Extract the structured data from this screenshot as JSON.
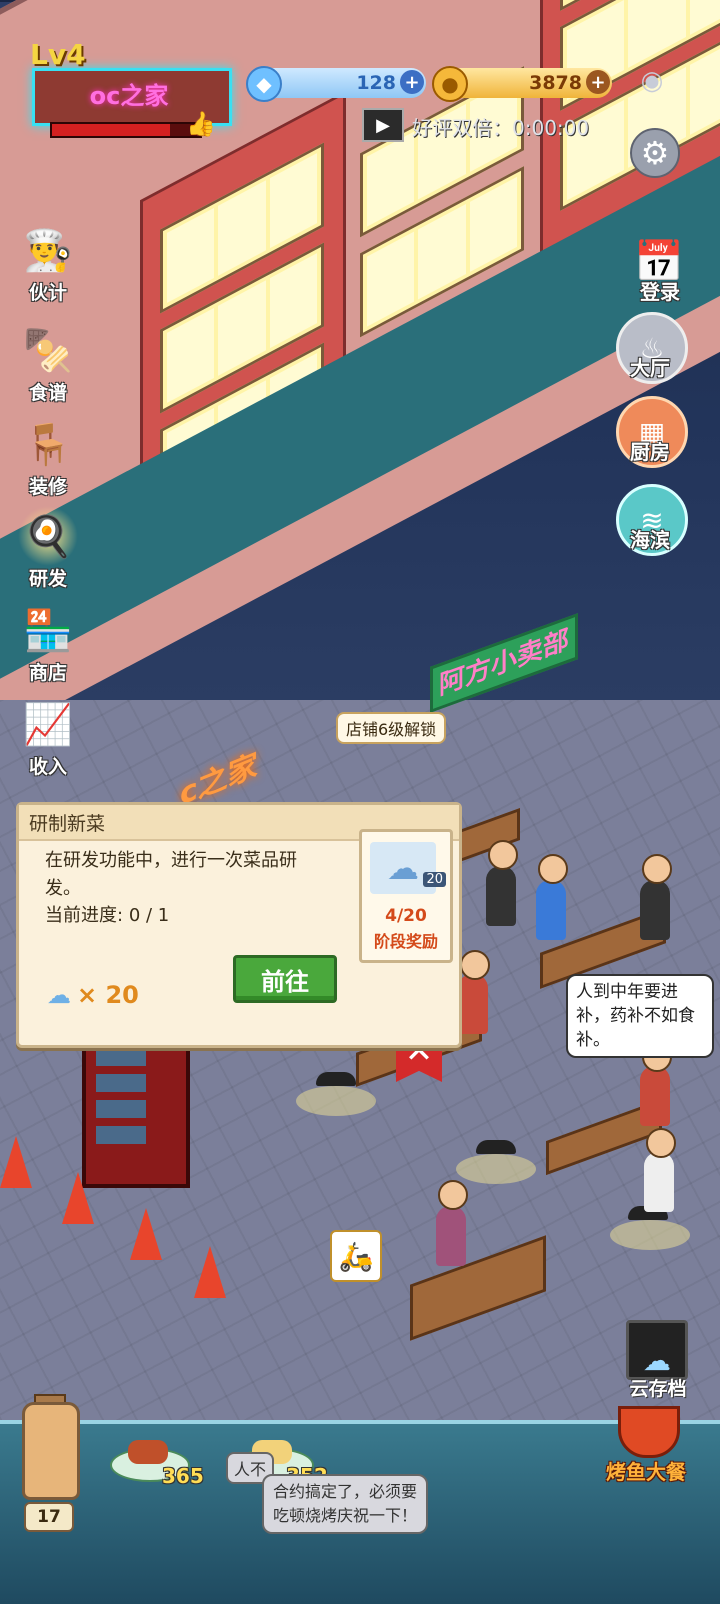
{
  "hud": {
    "level": "Lv4",
    "shop_name": "oc之家",
    "xp_progress": 0.8,
    "gems": "128",
    "gold": "3878",
    "double_reward_label": "好评双倍",
    "double_reward_timer": "0:00:00"
  },
  "left_menu": [
    {
      "label": "伙计",
      "icon": "chef-icon"
    },
    {
      "label": "食谱",
      "icon": "recipe-icon"
    },
    {
      "label": "装修",
      "icon": "table-icon"
    },
    {
      "label": "研发",
      "icon": "research-icon"
    },
    {
      "label": "商店",
      "icon": "shop-icon"
    },
    {
      "label": "收入",
      "icon": "income-chart-icon"
    }
  ],
  "right_menu": [
    {
      "label": "登录",
      "icon": "calendar-icon"
    },
    {
      "label": "大厅",
      "icon": "hall-icon"
    },
    {
      "label": "厨房",
      "icon": "kitchen-icon"
    },
    {
      "label": "海滨",
      "icon": "seaside-icon"
    }
  ],
  "scene": {
    "store_sign": "阿方小卖部",
    "home_sign": "c之家",
    "unlock_tag": "店铺6级解锁"
  },
  "task": {
    "title": "研制新菜",
    "description": "在研发功能中，进行一次菜品研发。",
    "progress_label": "当前进度:",
    "progress_value": "0 / 1",
    "reward_qty": "× 20",
    "go_button": "前往",
    "stage_badge": "20",
    "stage_count": "4/20",
    "stage_label": "阶段奖励"
  },
  "bubbles": {
    "customer_right": "人到中年要进补，药补不如食补。",
    "customer_bottom": "合约搞定了，必须要吃顿烧烤庆祝一下！",
    "customer_partial": "人不"
  },
  "cloud_save": "云存档",
  "bottom_bar": {
    "bottle_count": "17",
    "dishes": [
      {
        "count": "365",
        "color": "#c0502a"
      },
      {
        "count": "352",
        "color": "#f2d27a"
      }
    ],
    "feast_label": "烤鱼大餐"
  },
  "colors": {
    "neon_cyan": "#39e0f2",
    "neon_pink": "#ff6fe0",
    "go_green": "#4aa83c",
    "reward_orange": "#d44a1a"
  }
}
